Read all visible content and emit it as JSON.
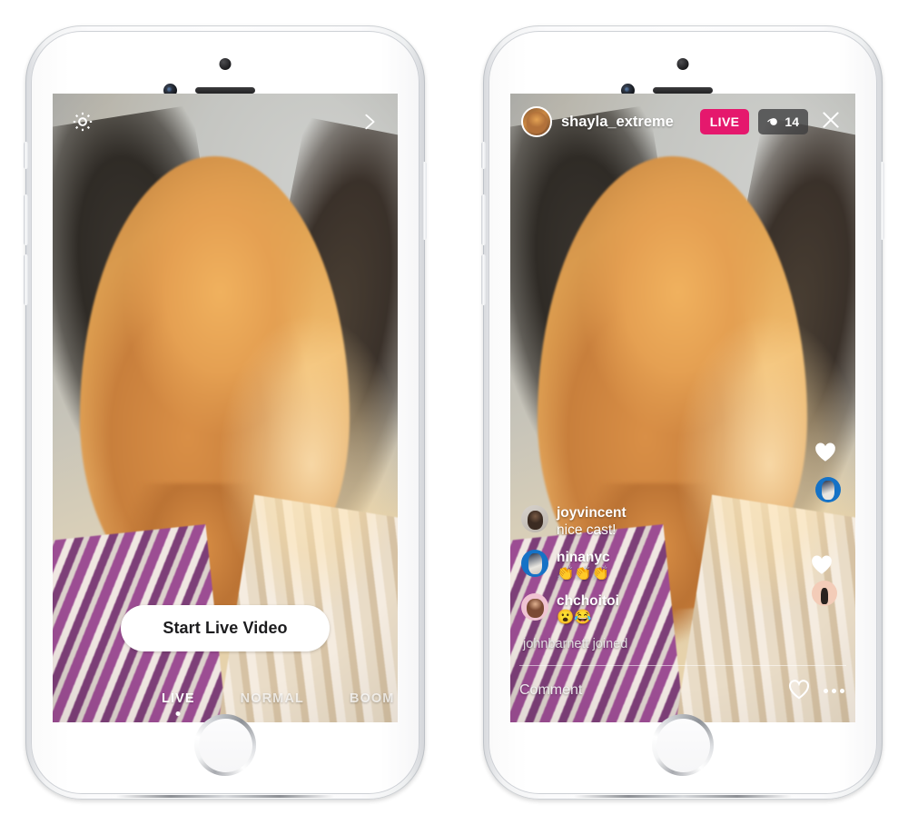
{
  "left_phone": {
    "name": "instagram-live-composer",
    "top_bar": {
      "settings_icon": "gear-icon",
      "next_icon": "chevron-right-icon"
    },
    "cta_label": "Start Live Video",
    "modes": [
      {
        "label": "LIVE",
        "active": true
      },
      {
        "label": "NORMAL",
        "active": false
      },
      {
        "label": "BOOM",
        "active": false
      }
    ]
  },
  "right_phone": {
    "name": "instagram-live-broadcast",
    "header": {
      "avatar": "profile-avatar",
      "username": "shayla_extreme",
      "live_badge": "LIVE",
      "viewer_icon": "eye-icon",
      "viewer_count": "14",
      "close_icon": "close-icon"
    },
    "comments": [
      {
        "username": "joyvincent",
        "text": "nice cast!"
      },
      {
        "username": "ninanyc",
        "text": "👏👏👏"
      },
      {
        "username": "chchoitoi",
        "text": "😮😂"
      }
    ],
    "join_notice": "johnbarnett joined",
    "comment_bar": {
      "placeholder": "Comment",
      "heart_icon": "heart-outline-icon",
      "more_icon": "more-options-icon"
    }
  },
  "colors": {
    "live_badge": "#e5186d",
    "viewer_pill": "#3c3c3e",
    "cta_background": "#ffffff",
    "cta_text": "#1c1c1e",
    "overlay_text": "#ffffff"
  }
}
